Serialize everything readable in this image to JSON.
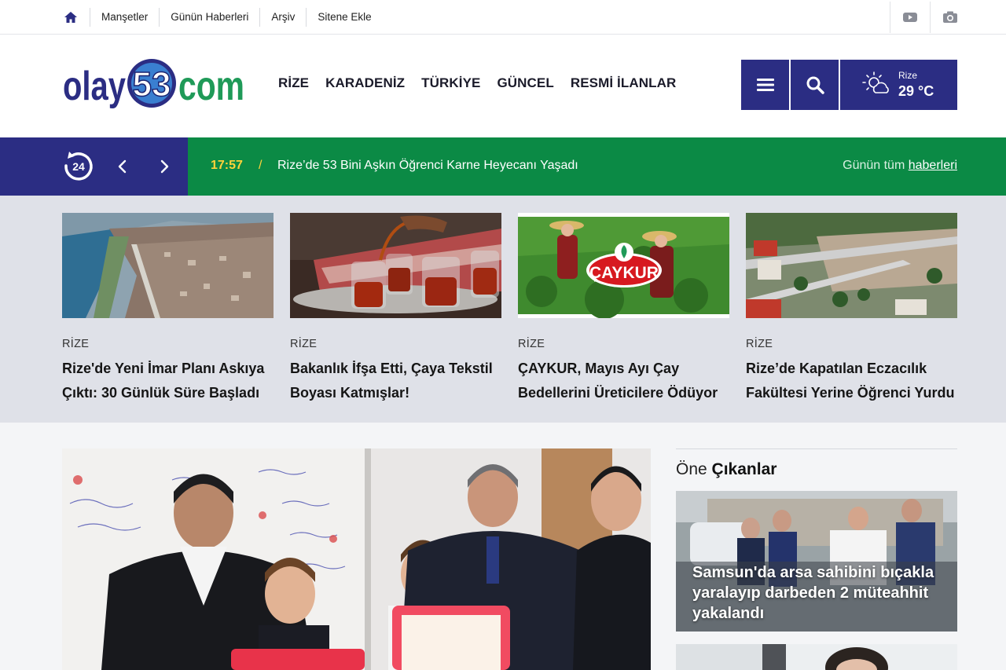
{
  "topbar": {
    "links": [
      "Manşetler",
      "Günün Haberleri",
      "Arşiv",
      "Sitene Ekle"
    ]
  },
  "header": {
    "logo": {
      "prefix": "olay",
      "number": "53",
      "suffix": "com"
    },
    "nav": [
      "RİZE",
      "KARADENİZ",
      "TÜRKİYE",
      "GÜNCEL",
      "RESMİ İLANLAR"
    ],
    "weather": {
      "city": "Rize",
      "temp": "29 °C"
    }
  },
  "ticker": {
    "badge": "24",
    "time": "17:57",
    "separator": "/",
    "headline": "Rize’de 53 Bini Aşkın Öğrenci Karne Heyecanı Yaşadı",
    "all_prefix": "Günün tüm",
    "all_link": "haberleri"
  },
  "cards": [
    {
      "category": "RİZE",
      "title": "Rize'de Yeni İmar Planı Askıya Çıktı: 30 Günlük Süre Başladı"
    },
    {
      "category": "RİZE",
      "title": "Bakanlık İfşa Etti, Çaya Tekstil Boyası Katmışlar!"
    },
    {
      "category": "RİZE",
      "title": "ÇAYKUR, Mayıs Ayı Çay Bedellerini Üreticilere Ödüyor",
      "logo_text": "ÇAYKUR"
    },
    {
      "category": "RİZE",
      "title": "Rize’de Kapatılan Eczacılık Fakültesi Yerine Öğrenci Yurdu"
    }
  ],
  "sidebar": {
    "title_light": "Öne",
    "title_bold": "Çıkanlar",
    "featured_caption": "Samsun'da arsa sahibini bıçakla yaralayıp darbeden 2 müteahhit yakalandı"
  },
  "colors": {
    "brand_blue": "#2b2d83",
    "ticker_green": "#0b8a45",
    "ticker_time": "#ffd23a",
    "logo_green": "#1f9a58"
  }
}
